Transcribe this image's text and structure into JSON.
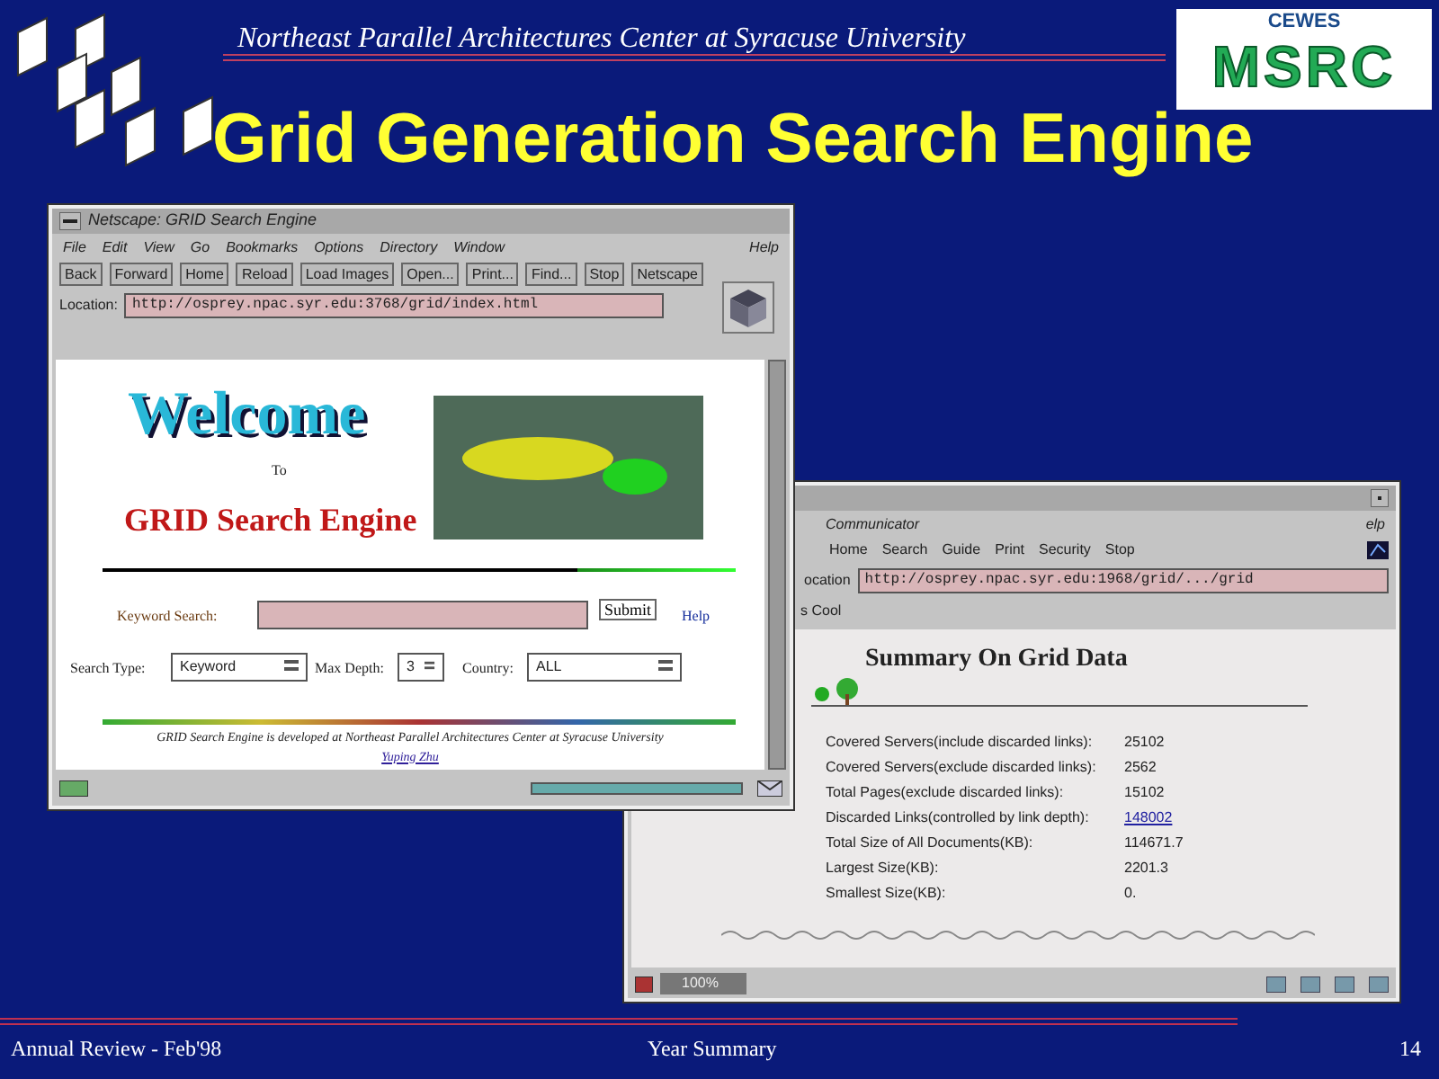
{
  "header": {
    "affiliation": "Northeast Parallel Architectures Center at Syracuse University",
    "logo_small": "CEWES",
    "logo_large": "MSRC"
  },
  "title": "Grid Generation Search Engine",
  "window_1": {
    "title": "Netscape: GRID Search Engine",
    "menu": [
      "File",
      "Edit",
      "View",
      "Go",
      "Bookmarks",
      "Options",
      "Directory",
      "Window"
    ],
    "help_menu": "Help",
    "toolbar": [
      "Back",
      "Forward",
      "Home",
      "Reload",
      "Load Images",
      "Open...",
      "Print...",
      "Find...",
      "Stop",
      "Netscape"
    ],
    "location_label": "Location:",
    "location": "http://osprey.npac.syr.edu:3768/grid/index.html",
    "page": {
      "welcome": "Welcome",
      "to": "To",
      "heading": "GRID Search Engine",
      "keyword_label": "Keyword Search:",
      "submit": "Submit",
      "help": "Help",
      "search_type_label": "Search Type:",
      "search_type": "Keyword",
      "max_depth_label": "Max Depth:",
      "max_depth": "3",
      "country_label": "Country:",
      "country": "ALL",
      "footer": "GRID Search Engine is developed at *Northeast Parallel Architectures Center* at Syracuse University",
      "footer_link": "Yuping Zhu"
    }
  },
  "window_2": {
    "menu": [
      "Communicator"
    ],
    "help_menu": "elp",
    "toolbar": [
      "Home",
      "Search",
      "Guide",
      "Print",
      "Security",
      "Stop"
    ],
    "location_label": "ocation",
    "location": "http://osprey.npac.syr.edu:1968/grid/.../grid",
    "bookmark": "s Cool",
    "page": {
      "heading": "Summary On Grid Data",
      "stats": [
        {
          "label": "Covered Servers(include discarded links):",
          "value": "25102",
          "link": false
        },
        {
          "label": "Covered Servers(exclude discarded links):",
          "value": "2562",
          "link": false
        },
        {
          "label": "Total Pages(exclude discarded links):",
          "value": "15102",
          "link": false
        },
        {
          "label": "Discarded Links(controlled by link depth):",
          "value": "148002",
          "link": true
        },
        {
          "label": "Total Size of All Documents(KB):",
          "value": "114671.7",
          "link": false
        },
        {
          "label": "Largest Size(KB):",
          "value": "2201.3",
          "link": false
        },
        {
          "label": "Smallest Size(KB):",
          "value": "0.",
          "link": false
        }
      ]
    },
    "zoom": "100%"
  },
  "footer": {
    "left": "Annual Review - Feb'98",
    "center": "Year Summary",
    "page": "14"
  }
}
